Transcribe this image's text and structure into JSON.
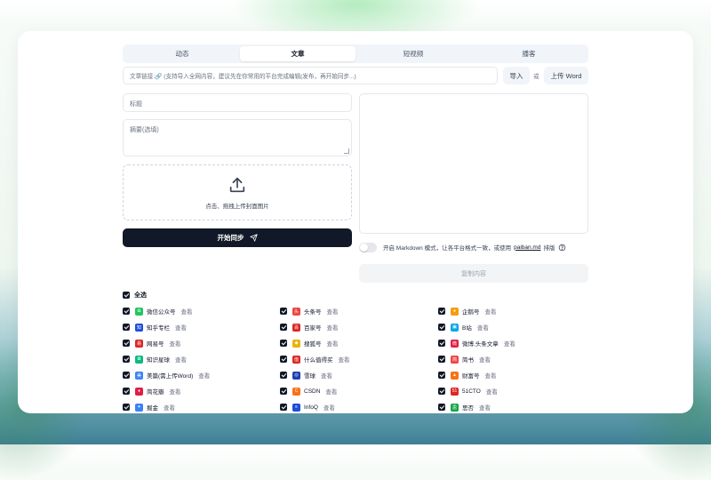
{
  "tabs": [
    {
      "label": "动态",
      "active": false
    },
    {
      "label": "文章",
      "active": true
    },
    {
      "label": "短视频",
      "active": false
    },
    {
      "label": "播客",
      "active": false
    }
  ],
  "link_input": {
    "placeholder": "文章链接:🔗 (支持导入全网内容，建议先在你常用的平台完成编辑(发布，再开始同步...)"
  },
  "import_label": "导入",
  "or_label": "或",
  "upload_word_label": "上传 Word",
  "title_placeholder": "标题",
  "summary_placeholder": "摘要(选填)",
  "upload_text": "点击、拖拽上传封面图片",
  "sync_label": "开始同步",
  "markdown": {
    "prefix": "开启 Markdown 模式，让各平台格式一致，或使用",
    "link": "paiban.md",
    "suffix": "排版"
  },
  "copy_label": "复制内容",
  "select_all_label": "全选",
  "view_label": "查看",
  "platforms": [
    [
      {
        "name": "微信公众号",
        "icon": "wechat-icon",
        "color": "#22c55e"
      },
      {
        "name": "头条号",
        "icon": "toutiao-icon",
        "color": "#ef4444"
      },
      {
        "name": "企鹅号",
        "icon": "penguin-icon",
        "color": "#f59e0b"
      }
    ],
    [
      {
        "name": "知乎专栏",
        "icon": "zhihu-icon",
        "color": "#1d4ed8"
      },
      {
        "name": "百家号",
        "icon": "baijia-icon",
        "color": "#dc2626"
      },
      {
        "name": "B站",
        "icon": "bilibili-icon",
        "color": "#0ea5e9"
      }
    ],
    [
      {
        "name": "网易号",
        "icon": "netease-icon",
        "color": "#dc2626"
      },
      {
        "name": "搜狐号",
        "icon": "sohu-icon",
        "color": "#eab308"
      },
      {
        "name": "微博.头条文章",
        "icon": "weibo-icon",
        "color": "#e11d48"
      }
    ],
    [
      {
        "name": "知识星球",
        "icon": "zsxq-icon",
        "color": "#10b981"
      },
      {
        "name": "什么值得买",
        "icon": "smzdm-icon",
        "color": "#dc2626"
      },
      {
        "name": "简书",
        "icon": "jianshu-icon",
        "color": "#ef4444"
      }
    ],
    [
      {
        "name": "美篇(需上传Word)",
        "icon": "meipian-icon",
        "color": "#3b82f6"
      },
      {
        "name": "雪球",
        "icon": "xueqiu-icon",
        "color": "#1e40af"
      },
      {
        "name": "财富号",
        "icon": "caifu-icon",
        "color": "#f97316"
      }
    ],
    [
      {
        "name": "简花瓣",
        "icon": "huaban-icon",
        "color": "#e11d48"
      },
      {
        "name": "CSDN",
        "icon": "csdn-icon",
        "color": "#f97316"
      },
      {
        "name": "51CTO",
        "icon": "51cto-icon",
        "color": "#dc2626"
      }
    ],
    [
      {
        "name": "掘金",
        "icon": "juejin-icon",
        "color": "#3b82f6"
      },
      {
        "name": "InfoQ",
        "icon": "infoq-icon",
        "color": "#1d4ed8"
      },
      {
        "name": "思否",
        "icon": "sifou-icon",
        "color": "#16a34a"
      }
    ]
  ]
}
